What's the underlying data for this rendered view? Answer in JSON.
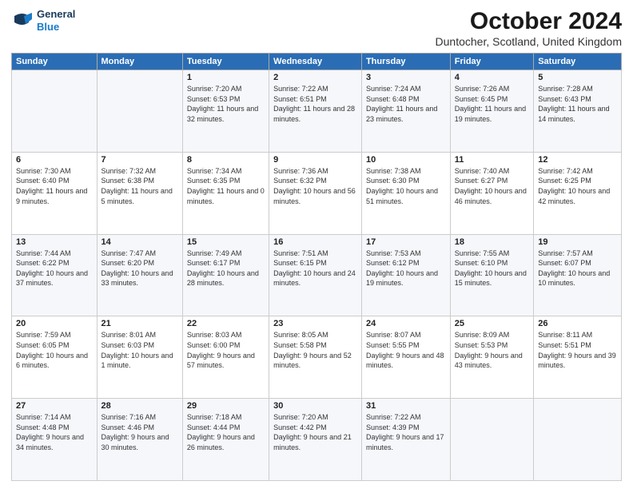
{
  "logo": {
    "line1": "General",
    "line2": "Blue"
  },
  "title": "October 2024",
  "subtitle": "Duntocher, Scotland, United Kingdom",
  "days_of_week": [
    "Sunday",
    "Monday",
    "Tuesday",
    "Wednesday",
    "Thursday",
    "Friday",
    "Saturday"
  ],
  "weeks": [
    [
      {
        "day": "",
        "sunrise": "",
        "sunset": "",
        "daylight": ""
      },
      {
        "day": "",
        "sunrise": "",
        "sunset": "",
        "daylight": ""
      },
      {
        "day": "1",
        "sunrise": "Sunrise: 7:20 AM",
        "sunset": "Sunset: 6:53 PM",
        "daylight": "Daylight: 11 hours and 32 minutes."
      },
      {
        "day": "2",
        "sunrise": "Sunrise: 7:22 AM",
        "sunset": "Sunset: 6:51 PM",
        "daylight": "Daylight: 11 hours and 28 minutes."
      },
      {
        "day": "3",
        "sunrise": "Sunrise: 7:24 AM",
        "sunset": "Sunset: 6:48 PM",
        "daylight": "Daylight: 11 hours and 23 minutes."
      },
      {
        "day": "4",
        "sunrise": "Sunrise: 7:26 AM",
        "sunset": "Sunset: 6:45 PM",
        "daylight": "Daylight: 11 hours and 19 minutes."
      },
      {
        "day": "5",
        "sunrise": "Sunrise: 7:28 AM",
        "sunset": "Sunset: 6:43 PM",
        "daylight": "Daylight: 11 hours and 14 minutes."
      }
    ],
    [
      {
        "day": "6",
        "sunrise": "Sunrise: 7:30 AM",
        "sunset": "Sunset: 6:40 PM",
        "daylight": "Daylight: 11 hours and 9 minutes."
      },
      {
        "day": "7",
        "sunrise": "Sunrise: 7:32 AM",
        "sunset": "Sunset: 6:38 PM",
        "daylight": "Daylight: 11 hours and 5 minutes."
      },
      {
        "day": "8",
        "sunrise": "Sunrise: 7:34 AM",
        "sunset": "Sunset: 6:35 PM",
        "daylight": "Daylight: 11 hours and 0 minutes."
      },
      {
        "day": "9",
        "sunrise": "Sunrise: 7:36 AM",
        "sunset": "Sunset: 6:32 PM",
        "daylight": "Daylight: 10 hours and 56 minutes."
      },
      {
        "day": "10",
        "sunrise": "Sunrise: 7:38 AM",
        "sunset": "Sunset: 6:30 PM",
        "daylight": "Daylight: 10 hours and 51 minutes."
      },
      {
        "day": "11",
        "sunrise": "Sunrise: 7:40 AM",
        "sunset": "Sunset: 6:27 PM",
        "daylight": "Daylight: 10 hours and 46 minutes."
      },
      {
        "day": "12",
        "sunrise": "Sunrise: 7:42 AM",
        "sunset": "Sunset: 6:25 PM",
        "daylight": "Daylight: 10 hours and 42 minutes."
      }
    ],
    [
      {
        "day": "13",
        "sunrise": "Sunrise: 7:44 AM",
        "sunset": "Sunset: 6:22 PM",
        "daylight": "Daylight: 10 hours and 37 minutes."
      },
      {
        "day": "14",
        "sunrise": "Sunrise: 7:47 AM",
        "sunset": "Sunset: 6:20 PM",
        "daylight": "Daylight: 10 hours and 33 minutes."
      },
      {
        "day": "15",
        "sunrise": "Sunrise: 7:49 AM",
        "sunset": "Sunset: 6:17 PM",
        "daylight": "Daylight: 10 hours and 28 minutes."
      },
      {
        "day": "16",
        "sunrise": "Sunrise: 7:51 AM",
        "sunset": "Sunset: 6:15 PM",
        "daylight": "Daylight: 10 hours and 24 minutes."
      },
      {
        "day": "17",
        "sunrise": "Sunrise: 7:53 AM",
        "sunset": "Sunset: 6:12 PM",
        "daylight": "Daylight: 10 hours and 19 minutes."
      },
      {
        "day": "18",
        "sunrise": "Sunrise: 7:55 AM",
        "sunset": "Sunset: 6:10 PM",
        "daylight": "Daylight: 10 hours and 15 minutes."
      },
      {
        "day": "19",
        "sunrise": "Sunrise: 7:57 AM",
        "sunset": "Sunset: 6:07 PM",
        "daylight": "Daylight: 10 hours and 10 minutes."
      }
    ],
    [
      {
        "day": "20",
        "sunrise": "Sunrise: 7:59 AM",
        "sunset": "Sunset: 6:05 PM",
        "daylight": "Daylight: 10 hours and 6 minutes."
      },
      {
        "day": "21",
        "sunrise": "Sunrise: 8:01 AM",
        "sunset": "Sunset: 6:03 PM",
        "daylight": "Daylight: 10 hours and 1 minute."
      },
      {
        "day": "22",
        "sunrise": "Sunrise: 8:03 AM",
        "sunset": "Sunset: 6:00 PM",
        "daylight": "Daylight: 9 hours and 57 minutes."
      },
      {
        "day": "23",
        "sunrise": "Sunrise: 8:05 AM",
        "sunset": "Sunset: 5:58 PM",
        "daylight": "Daylight: 9 hours and 52 minutes."
      },
      {
        "day": "24",
        "sunrise": "Sunrise: 8:07 AM",
        "sunset": "Sunset: 5:55 PM",
        "daylight": "Daylight: 9 hours and 48 minutes."
      },
      {
        "day": "25",
        "sunrise": "Sunrise: 8:09 AM",
        "sunset": "Sunset: 5:53 PM",
        "daylight": "Daylight: 9 hours and 43 minutes."
      },
      {
        "day": "26",
        "sunrise": "Sunrise: 8:11 AM",
        "sunset": "Sunset: 5:51 PM",
        "daylight": "Daylight: 9 hours and 39 minutes."
      }
    ],
    [
      {
        "day": "27",
        "sunrise": "Sunrise: 7:14 AM",
        "sunset": "Sunset: 4:48 PM",
        "daylight": "Daylight: 9 hours and 34 minutes."
      },
      {
        "day": "28",
        "sunrise": "Sunrise: 7:16 AM",
        "sunset": "Sunset: 4:46 PM",
        "daylight": "Daylight: 9 hours and 30 minutes."
      },
      {
        "day": "29",
        "sunrise": "Sunrise: 7:18 AM",
        "sunset": "Sunset: 4:44 PM",
        "daylight": "Daylight: 9 hours and 26 minutes."
      },
      {
        "day": "30",
        "sunrise": "Sunrise: 7:20 AM",
        "sunset": "Sunset: 4:42 PM",
        "daylight": "Daylight: 9 hours and 21 minutes."
      },
      {
        "day": "31",
        "sunrise": "Sunrise: 7:22 AM",
        "sunset": "Sunset: 4:39 PM",
        "daylight": "Daylight: 9 hours and 17 minutes."
      },
      {
        "day": "",
        "sunrise": "",
        "sunset": "",
        "daylight": ""
      },
      {
        "day": "",
        "sunrise": "",
        "sunset": "",
        "daylight": ""
      }
    ]
  ]
}
